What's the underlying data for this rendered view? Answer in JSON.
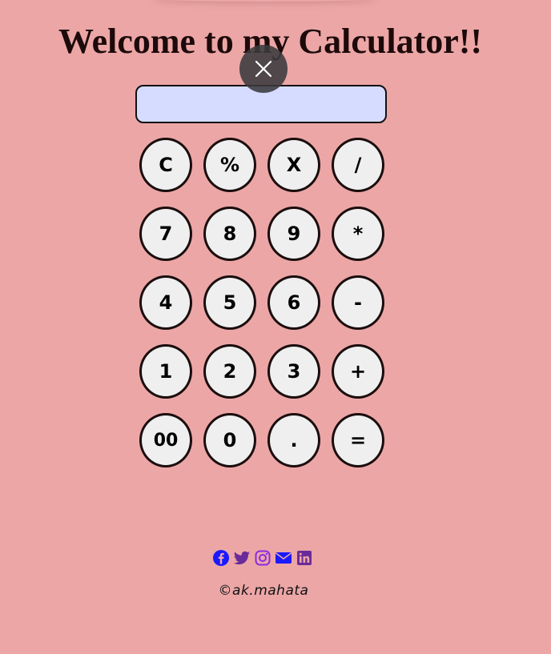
{
  "page": {
    "title": "Welcome to my Calculator!!",
    "background_color": "#eca6a6"
  },
  "overlay": {
    "close_icon": "close-icon"
  },
  "calculator": {
    "display_value": "",
    "display_color": "#d6dcff",
    "keys": [
      {
        "label": "C",
        "name": "clear"
      },
      {
        "label": "%",
        "name": "percent"
      },
      {
        "label": "X",
        "name": "backspace"
      },
      {
        "label": "/",
        "name": "divide"
      },
      {
        "label": "7",
        "name": "7"
      },
      {
        "label": "8",
        "name": "8"
      },
      {
        "label": "9",
        "name": "9"
      },
      {
        "label": "*",
        "name": "multiply"
      },
      {
        "label": "4",
        "name": "4"
      },
      {
        "label": "5",
        "name": "5"
      },
      {
        "label": "6",
        "name": "6"
      },
      {
        "label": "-",
        "name": "subtract"
      },
      {
        "label": "1",
        "name": "1"
      },
      {
        "label": "2",
        "name": "2"
      },
      {
        "label": "3",
        "name": "3"
      },
      {
        "label": "+",
        "name": "add"
      },
      {
        "label": "00",
        "name": "double-zero"
      },
      {
        "label": "0",
        "name": "0"
      },
      {
        "label": ".",
        "name": "decimal"
      },
      {
        "label": "=",
        "name": "equals"
      }
    ]
  },
  "footer": {
    "social": [
      {
        "icon": "facebook-icon",
        "color": "#1a1aff"
      },
      {
        "icon": "twitter-icon",
        "color": "#6a2b9a"
      },
      {
        "icon": "instagram-icon",
        "color": "#8a2be2"
      },
      {
        "icon": "email-icon",
        "color": "#1a1aff"
      },
      {
        "icon": "linkedin-icon",
        "color": "#6a2b9a"
      }
    ],
    "copyright": "©ak.mahata"
  }
}
